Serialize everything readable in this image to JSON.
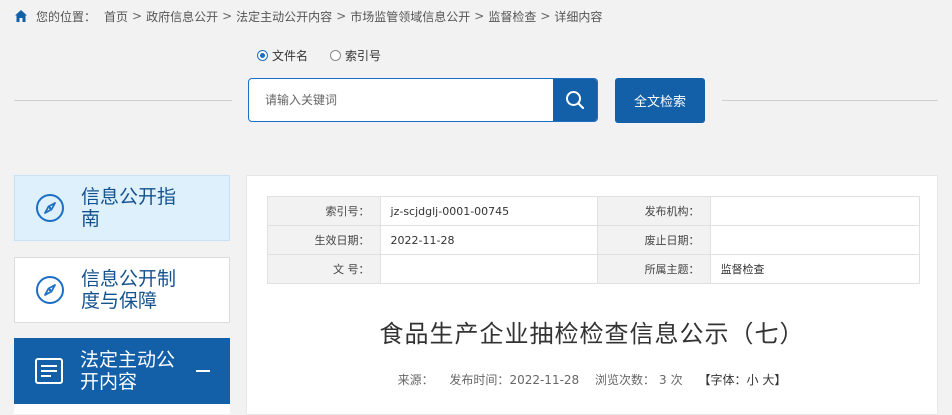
{
  "breadcrumb": {
    "prefix": "您的位置：",
    "items": [
      "首页",
      "政府信息公开",
      "法定主动公开内容",
      "市场监管领域信息公开",
      "监督检查",
      "详细内容"
    ],
    "separator": ">"
  },
  "search": {
    "options": [
      {
        "label": "文件名",
        "selected": true
      },
      {
        "label": "索引号",
        "selected": false
      }
    ],
    "placeholder": "请输入关键词",
    "fulltext_label": "全文检索"
  },
  "sidebar": {
    "items": [
      {
        "label": "信息公开指南",
        "icon": "compass-icon"
      },
      {
        "label": "信息公开制度与保障",
        "icon": "compass-icon"
      },
      {
        "label": "法定主动公开内容",
        "icon": "document-list-icon",
        "active": true
      }
    ]
  },
  "meta_table": {
    "rows": [
      {
        "k1": "索引号：",
        "v1": "jz-scjdglj-0001-00745",
        "k2": "发布机构：",
        "v2": ""
      },
      {
        "k1": "生效日期：",
        "v1": "2022-11-28",
        "k2": "废止日期：",
        "v2": ""
      },
      {
        "k1": "文 号：",
        "v1": "",
        "k2": "所属主题：",
        "v2": "监督检查"
      }
    ]
  },
  "article": {
    "title": "食品生产企业抽检检查信息公示（七）",
    "source_label": "来源：",
    "source_value": "",
    "published_label": "发布时间：",
    "published_value": "2022-11-28",
    "views_label": "浏览次数：",
    "views_value": "3",
    "views_unit": "次",
    "font_label": "【字体：",
    "font_small": "小",
    "font_large": "大",
    "font_close": "】"
  },
  "colors": {
    "primary": "#135fa8",
    "sidebar_light": "#ddf0fb",
    "background": "#f2f2f2"
  }
}
